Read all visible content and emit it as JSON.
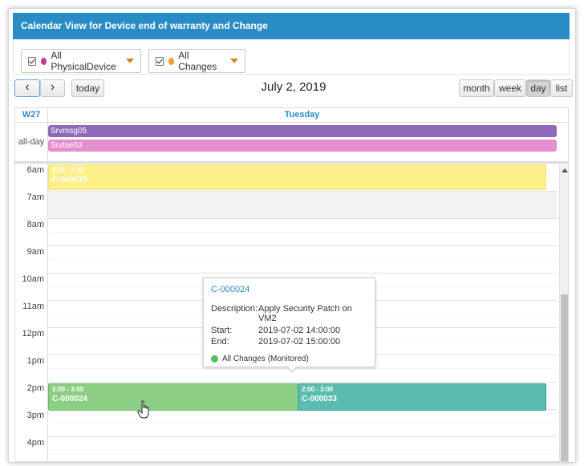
{
  "window": {
    "title": "Calendar View for Device end of warranty and Change"
  },
  "filters": [
    {
      "label": "All PhysicalDevice",
      "checked": true,
      "color": "#c2399f"
    },
    {
      "label": "All Changes",
      "checked": true,
      "color": "#f0a030"
    }
  ],
  "toolbar": {
    "prev_label": "‹",
    "next_label": "›",
    "today_label": "today",
    "date_title": "July 2, 2019",
    "views": [
      "month",
      "week",
      "day",
      "list"
    ],
    "active_view": "day"
  },
  "calendar": {
    "week_label": "W27",
    "day_header": "Tuesday",
    "allday_label": "all-day",
    "allday_events": [
      {
        "name": "Srvmsg05",
        "color": "#8e6bb8"
      },
      {
        "name": "Srvtse03",
        "color": "#e58fcf"
      }
    ],
    "hours": [
      "6am",
      "7am",
      "8am",
      "9am",
      "10am",
      "11am",
      "12pm",
      "1pm",
      "2pm",
      "3pm",
      "4pm"
    ],
    "events": [
      {
        "time": "6:00 - 7:00",
        "name": "C-000025",
        "color": "#fdf08a"
      },
      {
        "time": "2:00 - 3:00",
        "name": "C-000024",
        "color": "#8ccf84"
      },
      {
        "time": "2:00 - 3:00",
        "name": "C-000033",
        "color": "#5bbcb0"
      }
    ]
  },
  "popup": {
    "title": "C-000024",
    "description_label": "Description:",
    "description": "Apply Security Patch on VM2",
    "start_label": "Start:",
    "start": "2019-07-02 14:00:00",
    "end_label": "End:",
    "end": "2019-07-02 15:00:00",
    "legend": "All Changes (Monitored)",
    "legend_color": "#5cb85c"
  }
}
